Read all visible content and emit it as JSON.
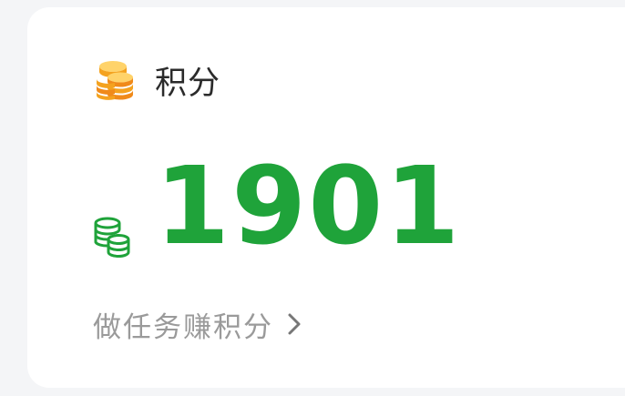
{
  "points_card": {
    "title": "积分",
    "title_icon": "coins-stack-icon",
    "value": "1901",
    "value_icon": "coins-stack-outline-icon",
    "earn_link_label": "做任务赚积分",
    "earn_link_icon": "chevron-right-icon"
  },
  "colors": {
    "accent_green": "#1fa33a",
    "coin_orange": "#f5a623",
    "title_text": "#2b2b2b",
    "link_text": "#9a9a9a",
    "background": "#f4f5f7",
    "card": "#ffffff"
  }
}
